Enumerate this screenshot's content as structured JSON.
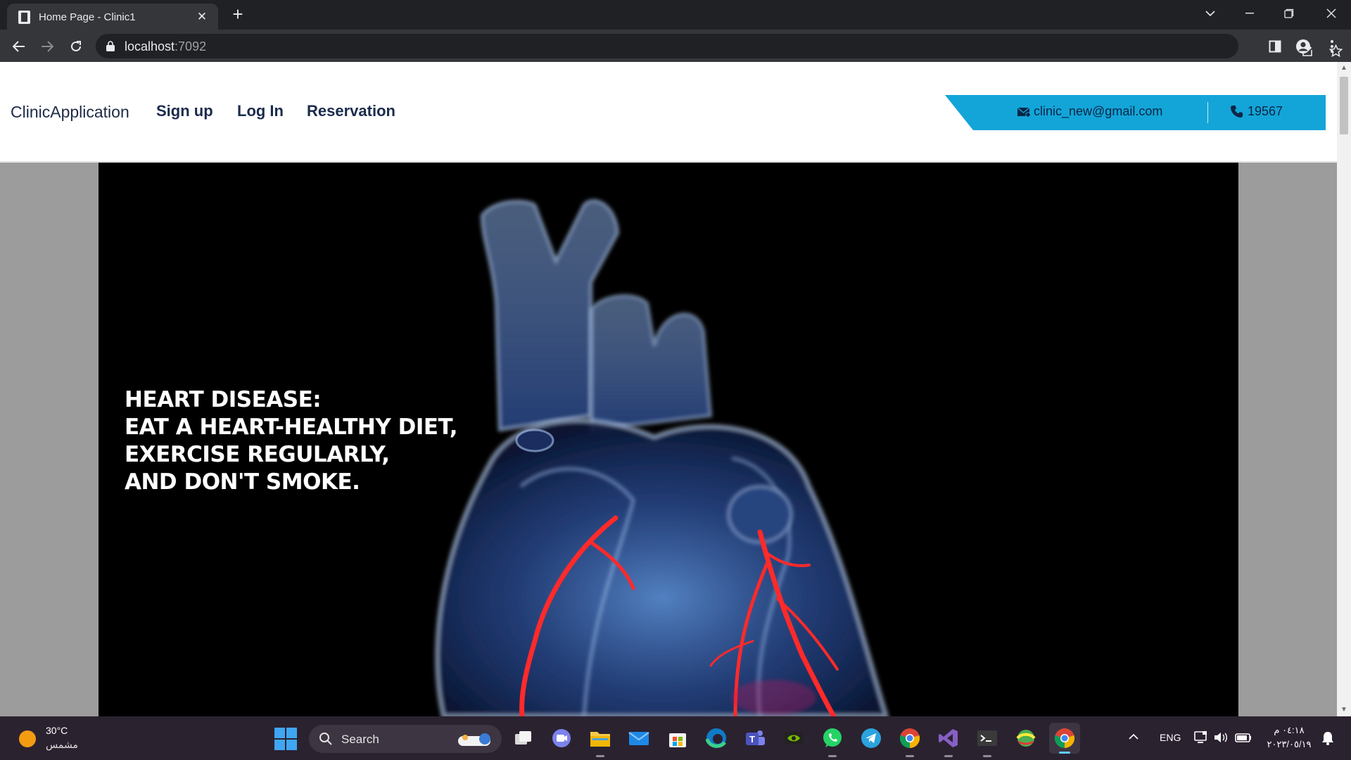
{
  "browser": {
    "tab_title": "Home Page - Clinic1",
    "tab_close": "✕",
    "new_tab": "+",
    "url_host": "localhost",
    "url_port": ":7092"
  },
  "site": {
    "brand": "ClinicApplication",
    "nav": {
      "signup": "Sign up",
      "login": "Log In",
      "reservation": "Reservation"
    },
    "contact": {
      "email": "clinic_new@gmail.com",
      "phone": "19567",
      "bar_color": "#13a5d8"
    },
    "hero": {
      "lines": [
        "HEART DISEASE:",
        "EAT A HEART-HEALTHY DIET,",
        "EXERCISE REGULARLY,",
        "AND DON'T SMOKE."
      ]
    }
  },
  "taskbar": {
    "weather": {
      "temp": "30°C",
      "condition": "مشمس"
    },
    "search_placeholder": "Search",
    "language": "ENG",
    "clock": {
      "time": "٠٤:١٨ م",
      "date": "٢٠٢٣/٠٥/١٩"
    },
    "icons": [
      "task-view-icon",
      "teams-chat-icon",
      "file-explorer-icon",
      "mail-icon",
      "microsoft-store-icon",
      "edge-icon",
      "teams-icon",
      "nvidia-icon",
      "whatsapp-icon",
      "telegram-icon",
      "chrome-icon",
      "visual-studio-icon",
      "terminal-icon",
      "earth-app-icon",
      "chrome-icon"
    ]
  }
}
